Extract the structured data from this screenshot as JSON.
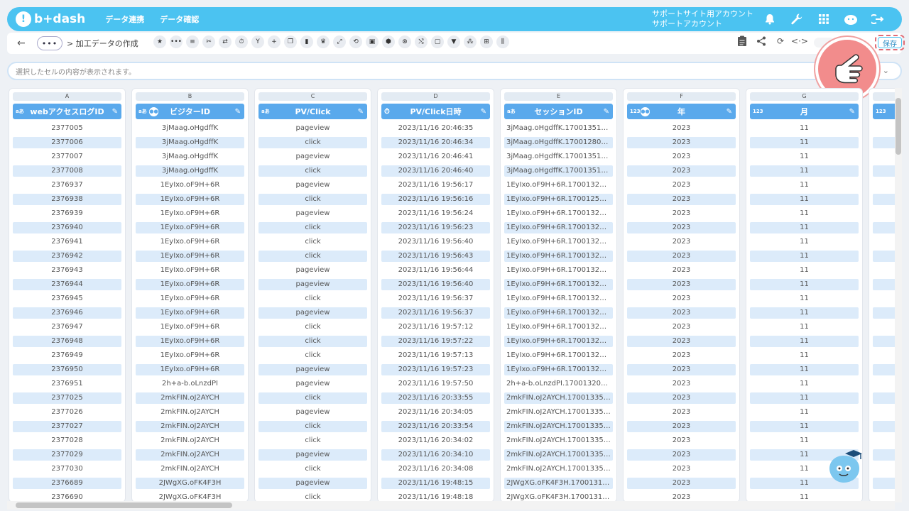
{
  "app": {
    "logo": "b+dash",
    "nav": [
      "データ連携",
      "データ確認"
    ],
    "account_line1": "サポートサイト用アカウント",
    "account_line2": "サポートアカウント"
  },
  "icons_top": [
    "bell-icon",
    "wrench-icon",
    "grid-icon",
    "mascot-icon",
    "logout-icon"
  ],
  "toolbar": {
    "back": "←",
    "crumb_dots": "•••",
    "breadcrumb": "> 加工データの作成",
    "save_label": "保存"
  },
  "cellbar": {
    "placeholder": "選択したセルの内容が表示されます。"
  },
  "columns": [
    {
      "letter": "A",
      "title": "webアクセスログID",
      "type": "aあ",
      "group": false
    },
    {
      "letter": "B",
      "title": "ビジターID",
      "type": "aあ",
      "group": true
    },
    {
      "letter": "C",
      "title": "PV/Click",
      "type": "aあ",
      "group": false
    },
    {
      "letter": "D",
      "title": "PV/Click日時",
      "type": "clock",
      "group": false
    },
    {
      "letter": "E",
      "title": "セッションID",
      "type": "aあ",
      "group": false
    },
    {
      "letter": "F",
      "title": "年",
      "type": "123",
      "group": true
    },
    {
      "letter": "G",
      "title": "月",
      "type": "123",
      "group": false
    }
  ],
  "rows": [
    [
      "2377005",
      "3jMaag.oHgdffK",
      "pageview",
      "2023/11/16 20:46:35",
      "3jMaag.oHgdffK.170013519...",
      "2023",
      "11"
    ],
    [
      "2377006",
      "3jMaag.oHgdffK",
      "click",
      "2023/11/16 20:46:34",
      "3jMaag.oHgdffK.170012801...",
      "2023",
      "11"
    ],
    [
      "2377007",
      "3jMaag.oHgdffK",
      "pageview",
      "2023/11/16 20:46:41",
      "3jMaag.oHgdffK.170013519...",
      "2023",
      "11"
    ],
    [
      "2377008",
      "3jMaag.oHgdffK",
      "click",
      "2023/11/16 20:46:40",
      "3jMaag.oHgdffK.170013519...",
      "2023",
      "11"
    ],
    [
      "2376937",
      "1EyIxo.oF9H+6R",
      "pageview",
      "2023/11/16 19:56:17",
      "1EyIxo.oF9H+6R.170013217...",
      "2023",
      "11"
    ],
    [
      "2376938",
      "1EyIxo.oF9H+6R",
      "click",
      "2023/11/16 19:56:16",
      "1EyIxo.oF9H+6R.170012582...",
      "2023",
      "11"
    ],
    [
      "2376939",
      "1EyIxo.oF9H+6R",
      "pageview",
      "2023/11/16 19:56:24",
      "1EyIxo.oF9H+6R.170013217...",
      "2023",
      "11"
    ],
    [
      "2376940",
      "1EyIxo.oF9H+6R",
      "click",
      "2023/11/16 19:56:23",
      "1EyIxo.oF9H+6R.170013217...",
      "2023",
      "11"
    ],
    [
      "2376941",
      "1EyIxo.oF9H+6R",
      "click",
      "2023/11/16 19:56:40",
      "1EyIxo.oF9H+6R.170013217...",
      "2023",
      "11"
    ],
    [
      "2376942",
      "1EyIxo.oF9H+6R",
      "click",
      "2023/11/16 19:56:43",
      "1EyIxo.oF9H+6R.170013217...",
      "2023",
      "11"
    ],
    [
      "2376943",
      "1EyIxo.oF9H+6R",
      "pageview",
      "2023/11/16 19:56:44",
      "1EyIxo.oF9H+6R.170013217...",
      "2023",
      "11"
    ],
    [
      "2376944",
      "1EyIxo.oF9H+6R",
      "pageview",
      "2023/11/16 19:56:40",
      "1EyIxo.oF9H+6R.170013217...",
      "2023",
      "11"
    ],
    [
      "2376945",
      "1EyIxo.oF9H+6R",
      "click",
      "2023/11/16 19:56:37",
      "1EyIxo.oF9H+6R.170013217...",
      "2023",
      "11"
    ],
    [
      "2376946",
      "1EyIxo.oF9H+6R",
      "pageview",
      "2023/11/16 19:56:37",
      "1EyIxo.oF9H+6R.170013217...",
      "2023",
      "11"
    ],
    [
      "2376947",
      "1EyIxo.oF9H+6R",
      "click",
      "2023/11/16 19:57:12",
      "1EyIxo.oF9H+6R.170013217...",
      "2023",
      "11"
    ],
    [
      "2376948",
      "1EyIxo.oF9H+6R",
      "click",
      "2023/11/16 19:57:22",
      "1EyIxo.oF9H+6R.170013217...",
      "2023",
      "11"
    ],
    [
      "2376949",
      "1EyIxo.oF9H+6R",
      "click",
      "2023/11/16 19:57:13",
      "1EyIxo.oF9H+6R.170013217...",
      "2023",
      "11"
    ],
    [
      "2376950",
      "1EyIxo.oF9H+6R",
      "pageview",
      "2023/11/16 19:57:23",
      "1EyIxo.oF9H+6R.170013217...",
      "2023",
      "11"
    ],
    [
      "2376951",
      "2h+a-b.oLnzdPI",
      "pageview",
      "2023/11/16 19:57:50",
      "2h+a-b.oLnzdPI.170013208...",
      "2023",
      "11"
    ],
    [
      "2377025",
      "2mkFIN.oJ2AYCH",
      "click",
      "2023/11/16 20:33:55",
      "2mkFIN.oJ2AYCH.170013355...",
      "2023",
      "11"
    ],
    [
      "2377026",
      "2mkFIN.oJ2AYCH",
      "pageview",
      "2023/11/16 20:34:05",
      "2mkFIN.oJ2AYCH.170013355...",
      "2023",
      "11"
    ],
    [
      "2377027",
      "2mkFIN.oJ2AYCH",
      "click",
      "2023/11/16 20:33:54",
      "2mkFIN.oJ2AYCH.170013355...",
      "2023",
      "11"
    ],
    [
      "2377028",
      "2mkFIN.oJ2AYCH",
      "click",
      "2023/11/16 20:34:02",
      "2mkFIN.oJ2AYCH.170013355...",
      "2023",
      "11"
    ],
    [
      "2377029",
      "2mkFIN.oJ2AYCH",
      "pageview",
      "2023/11/16 20:34:10",
      "2mkFIN.oJ2AYCH.170013355...",
      "2023",
      "11"
    ],
    [
      "2377030",
      "2mkFIN.oJ2AYCH",
      "click",
      "2023/11/16 20:34:08",
      "2mkFIN.oJ2AYCH.170013355...",
      "2023",
      "11"
    ],
    [
      "2376689",
      "2JWgXG.oFK4F3H",
      "pageview",
      "2023/11/16 19:48:15",
      "2JWgXG.oFK4F3H.17001316...",
      "2023",
      "11"
    ],
    [
      "2376690",
      "2JWgXG.oFK4F3H",
      "click",
      "2023/11/16 19:48:18",
      "2JWgXG.oFK4F3H.17001316...",
      "2023",
      "11"
    ]
  ],
  "partial_column_type": "123"
}
